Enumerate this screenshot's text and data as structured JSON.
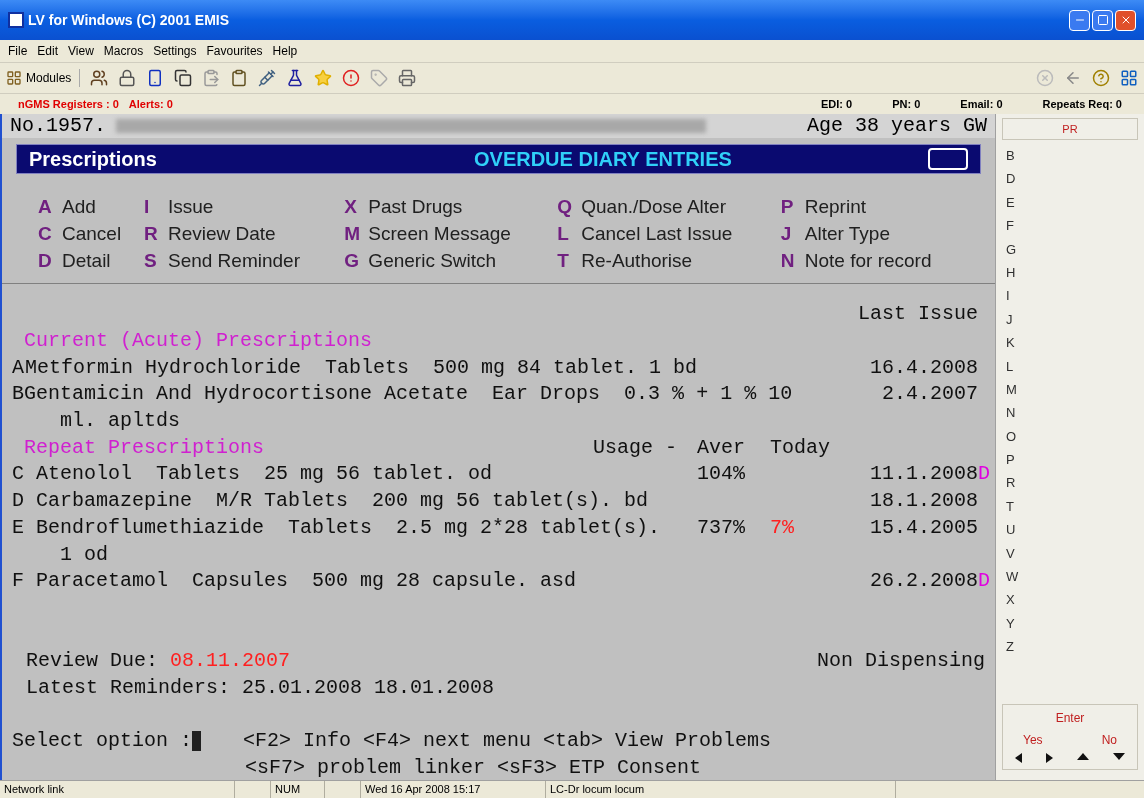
{
  "window": {
    "title": "LV for Windows (C) 2001 EMIS"
  },
  "menu": [
    "File",
    "Edit",
    "View",
    "Macros",
    "Settings",
    "Favourites",
    "Help"
  ],
  "toolbar": {
    "modules_label": "Modules"
  },
  "info_bar": {
    "left": [
      "nGMS Registers : 0",
      "Alerts: 0"
    ],
    "right": [
      "EDI: 0",
      "PN: 0",
      "Email: 0",
      "Repeats Req: 0"
    ]
  },
  "patient": {
    "number": "No.1957.",
    "age": "Age 38 years GW"
  },
  "header": {
    "title": "Prescriptions",
    "subtitle": "OVERDUE DIARY ENTRIES"
  },
  "options": [
    {
      "key": "A",
      "label": "Add"
    },
    {
      "key": "C",
      "label": "Cancel"
    },
    {
      "key": "D",
      "label": "Detail"
    },
    {
      "key": "I",
      "label": "Issue"
    },
    {
      "key": "R",
      "label": "Review Date"
    },
    {
      "key": "S",
      "label": "Send Reminder"
    },
    {
      "key": "X",
      "label": "Past Drugs"
    },
    {
      "key": "M",
      "label": "Screen Message"
    },
    {
      "key": "G",
      "label": "Generic Switch"
    },
    {
      "key": "Q",
      "label": "Quan./Dose Alter"
    },
    {
      "key": "L",
      "label": "Cancel Last Issue"
    },
    {
      "key": "T",
      "label": "Re-Authorise"
    },
    {
      "key": "P",
      "label": "Reprint"
    },
    {
      "key": "J",
      "label": "Alter Type"
    },
    {
      "key": "N",
      "label": "Note for record"
    }
  ],
  "last_issue_heading": "Last Issue",
  "sections": [
    {
      "heading": "Current (Acute) Prescriptions",
      "items": [
        {
          "letter": "A",
          "text": "Metformin Hydrochloride  Tablets  500 mg 84 tablet. 1 bd",
          "last_issue": "16.4.2008"
        },
        {
          "letter": "B",
          "text": "Gentamicin And Hydrocortisone Acetate  Ear Drops  0.3 % + 1 % 10",
          "continuation": "ml. apltds",
          "last_issue": "2.4.2007"
        }
      ]
    },
    {
      "heading": "Repeat Prescriptions",
      "usage_heading": "Usage -",
      "aver_heading": "Aver",
      "today_heading": "Today",
      "items": [
        {
          "letter": "C",
          "text": "Atenolol  Tablets  25 mg 56 tablet. od",
          "aver": "104%",
          "last_issue": "11.1.2008",
          "flag": "D"
        },
        {
          "letter": "D",
          "text": "Carbamazepine  M/R Tablets  200 mg 56 tablet(s). bd",
          "last_issue": "18.1.2008"
        },
        {
          "letter": "E",
          "text": "Bendroflumethiazide  Tablets  2.5 mg 2*28 tablet(s).",
          "continuation": "1 od",
          "aver": "737%",
          "today": "7%",
          "last_issue": "15.4.2005"
        },
        {
          "letter": "F",
          "text": "Paracetamol  Capsules  500 mg 28 capsule. asd",
          "last_issue": "26.2.2008",
          "flag": "D"
        }
      ]
    }
  ],
  "review": {
    "label": "Review Due:",
    "date": "08.11.2007",
    "dispensing": "Non Dispensing"
  },
  "reminders": "Latest Reminders: 25.01.2008 18.01.2008",
  "prompt": {
    "label": "Select option :",
    "line1": "<F2> Info <F4> next menu <tab> View Problems",
    "line2": "<sF7> problem linker <sF3> ETP Consent"
  },
  "side_panel": {
    "header": "PR",
    "letters": [
      "B",
      "D",
      "E",
      "F",
      "G",
      "H",
      "I",
      "J",
      "K",
      "L",
      "M",
      "N",
      "O",
      "P",
      "R",
      "T",
      "U",
      "V",
      "W",
      "X",
      "Y",
      "Z"
    ],
    "enter": "Enter",
    "yes": "Yes",
    "no": "No"
  },
  "status_bar": [
    "Network link",
    "NUM",
    "Wed 16 Apr 2008 15:17",
    "LC-Dr locum locum"
  ]
}
